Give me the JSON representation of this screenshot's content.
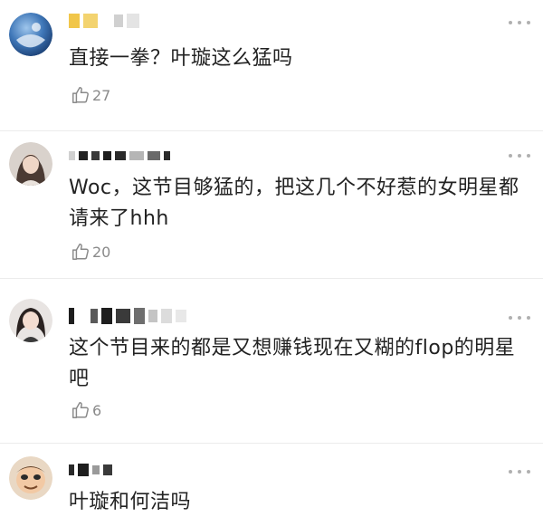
{
  "colors": {
    "text": "#222222",
    "meta": "#8a8a8a",
    "divider": "#ececec",
    "more_dots": "#b0b0b0"
  },
  "comments": [
    {
      "avatar_icon": "blue-sphere-avatar-icon",
      "text": "直接一拳？叶璇这么猛吗",
      "likes": "27"
    },
    {
      "avatar_icon": "woman-portrait-avatar-icon",
      "text": "Woc，这节目够猛的，把这几个不好惹的女明星都请来了hhh",
      "likes": "20"
    },
    {
      "avatar_icon": "girl-portrait-avatar-icon",
      "text": "这个节目来的都是又想赚钱现在又糊的flop的明星吧",
      "likes": "6"
    },
    {
      "avatar_icon": "cartoon-face-avatar-icon",
      "text": "叶璇和何洁吗",
      "likes": ""
    }
  ]
}
